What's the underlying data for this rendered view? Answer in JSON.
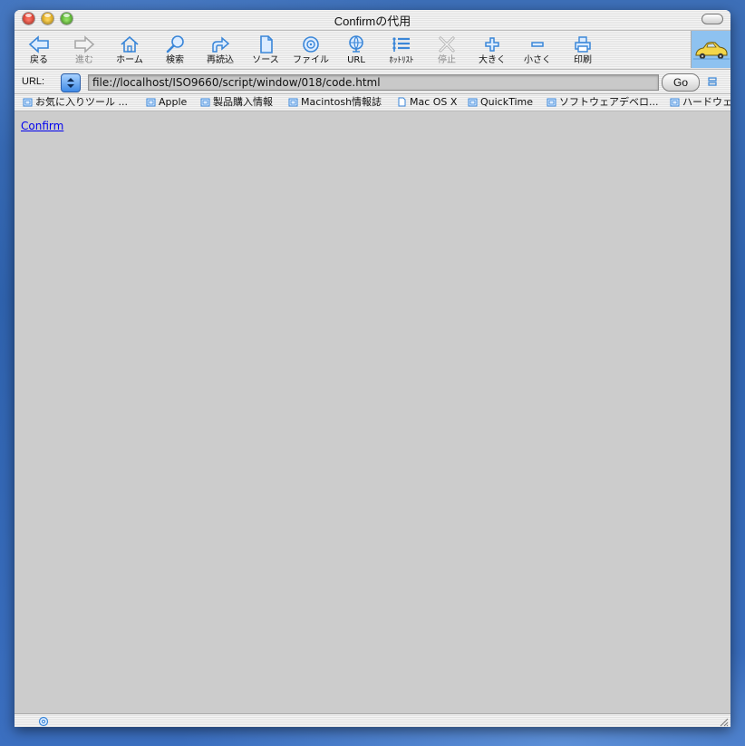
{
  "window": {
    "title": "Confirmの代用"
  },
  "toolbar": {
    "buttons": [
      {
        "label": "戻る",
        "icon": "back-arrow-icon",
        "enabled": true
      },
      {
        "label": "進む",
        "icon": "forward-arrow-icon",
        "enabled": false
      },
      {
        "label": "ホーム",
        "icon": "home-icon",
        "enabled": true
      },
      {
        "label": "検索",
        "icon": "search-icon",
        "enabled": true
      },
      {
        "label": "再読込",
        "icon": "reload-icon",
        "enabled": true
      },
      {
        "label": "ソース",
        "icon": "source-document-icon",
        "enabled": true
      },
      {
        "label": "ファイル",
        "icon": "file-disc-icon",
        "enabled": true
      },
      {
        "label": "URL",
        "icon": "url-globe-icon",
        "enabled": true
      },
      {
        "label": "ﾎｯﾄﾘｽﾄ",
        "icon": "hotlist-icon",
        "enabled": true
      },
      {
        "label": "停止",
        "icon": "stop-icon",
        "enabled": false
      },
      {
        "label": "大きく",
        "icon": "plus-icon",
        "enabled": true
      },
      {
        "label": "小さく",
        "icon": "minus-icon",
        "enabled": true
      },
      {
        "label": "印刷",
        "icon": "print-icon",
        "enabled": true
      }
    ]
  },
  "urlbar": {
    "label": "URL:",
    "value": "file://localhost/ISO9660/script/window/018/code.html",
    "go_label": "Go"
  },
  "favorites": [
    "お気に入りツール ...",
    "Apple",
    "製品購入情報",
    "Macintosh情報誌",
    "Mac OS X",
    "QuickTime",
    "ソフトウェアデベロ...",
    "ハードウェ"
  ],
  "content": {
    "link_text": "Confirm"
  },
  "colors": {
    "accent_icon": "#3a86d8",
    "link": "#0000ee",
    "content_bg": "#cccccc"
  }
}
